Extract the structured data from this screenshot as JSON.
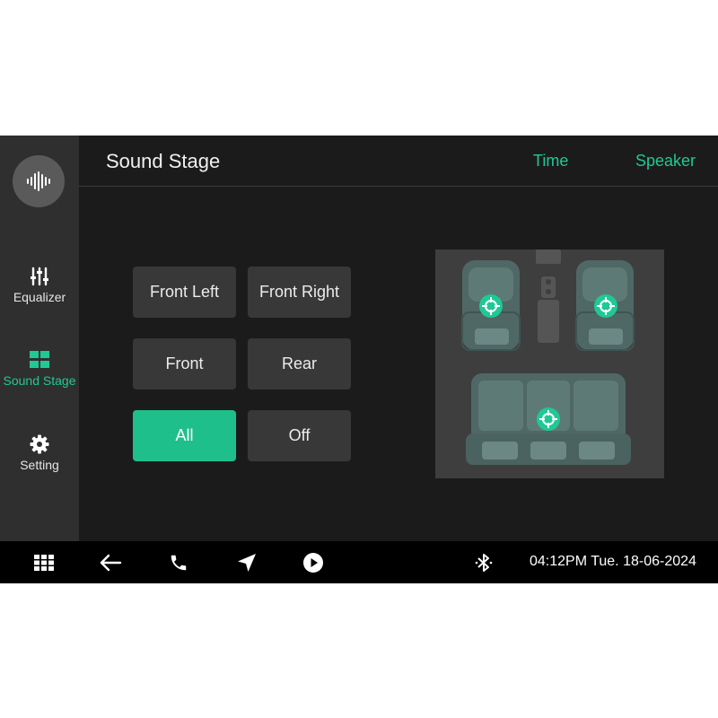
{
  "sidebar": {
    "logo_icon": "sound-wave-icon",
    "items": [
      {
        "label": "Equalizer",
        "icon": "equalizer-sliders-icon",
        "active": false
      },
      {
        "label": "Sound Stage",
        "icon": "grid-layout-icon",
        "active": true
      },
      {
        "label": "Setting",
        "icon": "gear-icon",
        "active": false
      }
    ]
  },
  "header": {
    "title": "Sound Stage",
    "tabs": [
      {
        "label": "Time"
      },
      {
        "label": "Speaker"
      }
    ]
  },
  "modes": {
    "front_left": "Front Left",
    "front_right": "Front Right",
    "front": "Front",
    "rear": "Rear",
    "all": "All",
    "off": "Off",
    "selected": "All"
  },
  "seat_diagram": {
    "markers": [
      "front-left-seat",
      "front-right-seat",
      "rear-bench"
    ],
    "marker_icon": "crosshair-target-icon"
  },
  "bottom_bar": {
    "icons": [
      "apps-grid-icon",
      "back-arrow-icon",
      "phone-icon",
      "navigation-arrow-icon",
      "play-icon",
      "bluetooth-icon"
    ],
    "datetime": "04:12PM Tue. 18-06-2024"
  },
  "colors": {
    "accent": "#1fc994",
    "active_button": "#1fbf8c",
    "background": "#1b1b1b",
    "sidebar": "#2f2f2f",
    "button": "#383838",
    "seat": "#4f6866"
  }
}
